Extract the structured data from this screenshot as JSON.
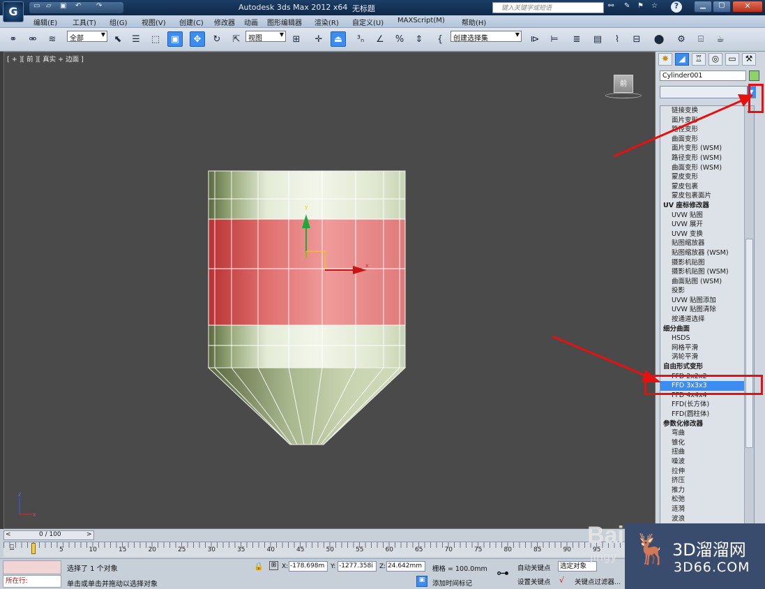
{
  "title_bar": {
    "app_title": "Autodesk 3ds Max  2012 x64",
    "doc_title": "无标题",
    "search_placeholder": "键入关键字或短语",
    "window_buttons": [
      "minimize-icon",
      "maximize-icon",
      "close-icon"
    ]
  },
  "menus": [
    "编辑(E)",
    "工具(T)",
    "组(G)",
    "视图(V)",
    "创建(C)",
    "修改器",
    "动画",
    "图形编辑器",
    "渲染(R)",
    "自定义(U)",
    "MAXScript(M)",
    "帮助(H)"
  ],
  "toolbar": {
    "selection_filter": "全部",
    "ref_coord": "视图",
    "named_selection": "创建选择集"
  },
  "viewport": {
    "label": "[ + ][ 前 ][ 真实 + 边面 ]",
    "viewcube_label": "前",
    "gizmo_y": "y",
    "gizmo_x": "x",
    "axis_z": "z",
    "axis_x": "x"
  },
  "command_panel": {
    "object_name": "Cylinder001",
    "object_color": "#8fd16a",
    "modifier_list": [
      {
        "label": "链接变换",
        "type": "item"
      },
      {
        "label": "面片变形",
        "type": "item"
      },
      {
        "label": "路径变形",
        "type": "item"
      },
      {
        "label": "曲面变形",
        "type": "item"
      },
      {
        "label": "面片变形 (WSM)",
        "type": "item"
      },
      {
        "label": "路径变形 (WSM)",
        "type": "item"
      },
      {
        "label": "曲面变形 (WSM)",
        "type": "item"
      },
      {
        "label": "蒙皮变形",
        "type": "item"
      },
      {
        "label": "蒙皮包裹",
        "type": "item"
      },
      {
        "label": "蒙皮包裹面片",
        "type": "item"
      },
      {
        "label": "UV 座标修改器",
        "type": "cat"
      },
      {
        "label": "UVW 贴图",
        "type": "item"
      },
      {
        "label": "UVW 展开",
        "type": "item"
      },
      {
        "label": "UVW 变换",
        "type": "item"
      },
      {
        "label": "贴图缩放器",
        "type": "item"
      },
      {
        "label": "贴图缩放器 (WSM)",
        "type": "item"
      },
      {
        "label": "摄影机贴图",
        "type": "item"
      },
      {
        "label": "摄影机贴图 (WSM)",
        "type": "item"
      },
      {
        "label": "曲面贴图 (WSM)",
        "type": "item"
      },
      {
        "label": "投影",
        "type": "item"
      },
      {
        "label": "UVW 贴图添加",
        "type": "item"
      },
      {
        "label": "UVW 贴图清除",
        "type": "item"
      },
      {
        "label": "按通道选择",
        "type": "item"
      },
      {
        "label": "细分曲面",
        "type": "cat"
      },
      {
        "label": "HSDS",
        "type": "item"
      },
      {
        "label": "网格平滑",
        "type": "item"
      },
      {
        "label": "涡轮平滑",
        "type": "item"
      },
      {
        "label": "自由形式变形",
        "type": "cat"
      },
      {
        "label": "FFD 2x2x2",
        "type": "item"
      },
      {
        "label": "FFD 3x3x3",
        "type": "sel"
      },
      {
        "label": "FFD 4x4x4",
        "type": "item"
      },
      {
        "label": "FFD(长方体)",
        "type": "item"
      },
      {
        "label": "FFD(圆柱体)",
        "type": "item"
      },
      {
        "label": "参数化修改器",
        "type": "cat"
      },
      {
        "label": "弯曲",
        "type": "item"
      },
      {
        "label": "锥化",
        "type": "item"
      },
      {
        "label": "扭曲",
        "type": "item"
      },
      {
        "label": "噪波",
        "type": "item"
      },
      {
        "label": "拉伸",
        "type": "item"
      },
      {
        "label": "挤压",
        "type": "item"
      },
      {
        "label": "推力",
        "type": "item"
      },
      {
        "label": "松弛",
        "type": "item"
      },
      {
        "label": "涟漪",
        "type": "item"
      },
      {
        "label": "波浪",
        "type": "item"
      }
    ]
  },
  "timeline": {
    "frame_display": "0 / 100",
    "ticks": [
      "5",
      "10",
      "15",
      "20",
      "25",
      "30",
      "35",
      "40",
      "45",
      "50",
      "55",
      "60",
      "65",
      "70",
      "75",
      "80",
      "85",
      "90",
      "95"
    ]
  },
  "status": {
    "selection_info": "选择了 1 个对象",
    "prompt": "单击或单击并拖动以选择对象",
    "script_label": "所在行:",
    "x_label": "X:",
    "x_value": "-178.698m",
    "y_label": "Y:",
    "y_value": "-1277.358i",
    "z_label": "Z:",
    "z_value": "24.642mm",
    "grid": "栅格 = 100.0mm",
    "auto_key": "自动关键点",
    "set_key": "设置关键点",
    "selected": "选定对象",
    "add_time_tag": "添加时间标记",
    "key_filters": "关键点过滤器..."
  },
  "watermark": {
    "brand": "3D溜溜网",
    "url": "3D66.COM",
    "baidu": "Bai",
    "jingyan": "jingy"
  }
}
